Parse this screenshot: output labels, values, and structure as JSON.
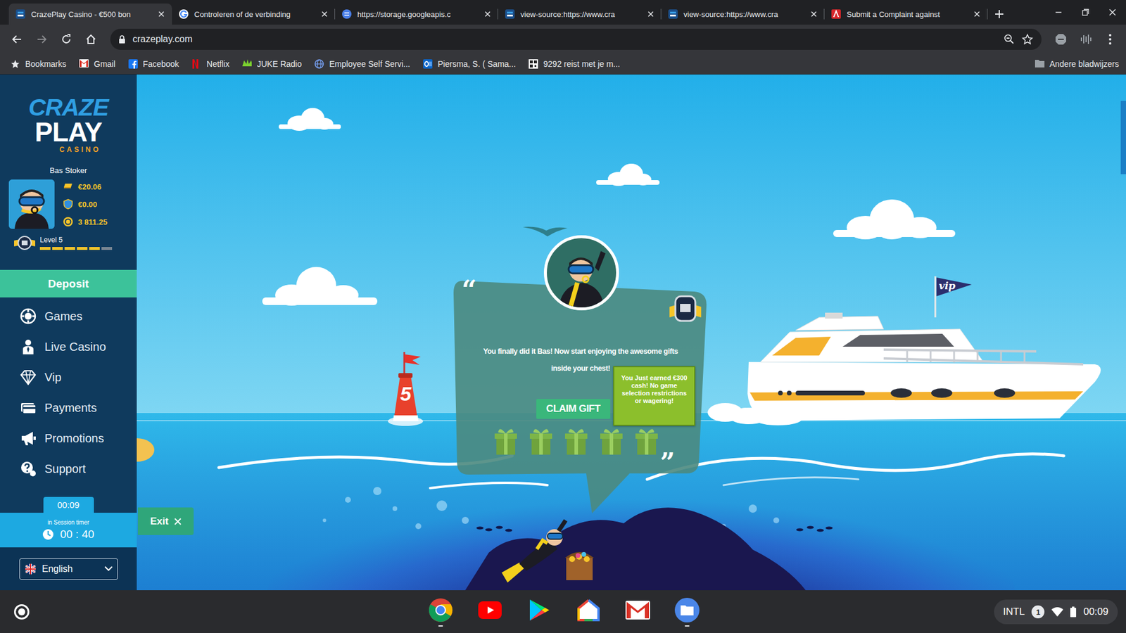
{
  "browser": {
    "tabs": [
      {
        "label": "CrazePlay Casino - €500 bon",
        "selected": true,
        "kind": "crazeplay"
      },
      {
        "label": "Controleren of de verbinding",
        "selected": false,
        "kind": "google"
      },
      {
        "label": "https://storage.googleapis.c",
        "selected": false,
        "kind": "storage"
      },
      {
        "label": "view-source:https://www.cra",
        "selected": false,
        "kind": "crazeplay"
      },
      {
        "label": "view-source:https://www.cra",
        "selected": false,
        "kind": "crazeplay"
      },
      {
        "label": "Submit a Complaint against",
        "selected": false,
        "kind": "complaint"
      }
    ],
    "address": "crazeplay.com",
    "bookmarks": [
      {
        "label": "Bookmarks",
        "kind": "star"
      },
      {
        "label": "Gmail",
        "kind": "gmail"
      },
      {
        "label": "Facebook",
        "kind": "facebook"
      },
      {
        "label": "Netflix",
        "kind": "netflix"
      },
      {
        "label": "JUKE Radio",
        "kind": "juke"
      },
      {
        "label": "Employee Self Servi...",
        "kind": "globe"
      },
      {
        "label": "Piersma, S. ( Sama...",
        "kind": "outlook"
      },
      {
        "label": "9292 reist met je m...",
        "kind": "ov"
      }
    ],
    "other_bookmarks": "Andere bladwijzers"
  },
  "sidebar": {
    "logo": {
      "line1": "CRAZE",
      "line2": "PLAY",
      "line3": "CASINO"
    },
    "user": {
      "name": "Bas Stoker",
      "cash": "€20.06",
      "bonus": "€0.00",
      "coins": "3 811.25",
      "level": "Level 5",
      "level_progress": 0.83
    },
    "deposit": "Deposit",
    "items": [
      {
        "label": "Games",
        "kind": "games"
      },
      {
        "label": "Live Casino",
        "kind": "live"
      },
      {
        "label": "Vip",
        "kind": "vip"
      },
      {
        "label": "Payments",
        "kind": "payments"
      },
      {
        "label": "Promotions",
        "kind": "promotions"
      },
      {
        "label": "Support",
        "kind": "support"
      }
    ],
    "timer": "00:09",
    "session_label": "in Session timer",
    "session_time": "00 : 40",
    "language": "English"
  },
  "scene": {
    "buoy_number": "5",
    "yacht_flag": "vip",
    "popup": {
      "open_quote": "“",
      "message_lines": [
        "You finally did it Bas! Now start enjoying the awesome gifts",
        "inside your chest!"
      ],
      "button": "CLAIM GIFT",
      "gift_count": 5,
      "close_quote": "”"
    },
    "tooltip": "You Just earned €300 cash! No game selection restrictions or wagering!",
    "exit": "Exit"
  },
  "taskbar": {
    "apps": [
      {
        "kind": "chrome",
        "running": true
      },
      {
        "kind": "youtube",
        "running": false
      },
      {
        "kind": "play",
        "running": false
      },
      {
        "kind": "home",
        "running": false
      },
      {
        "kind": "gmail",
        "running": false
      },
      {
        "kind": "files",
        "running": true
      }
    ],
    "keyboard": "INTL",
    "notifications": "1",
    "clock": "00:09"
  }
}
